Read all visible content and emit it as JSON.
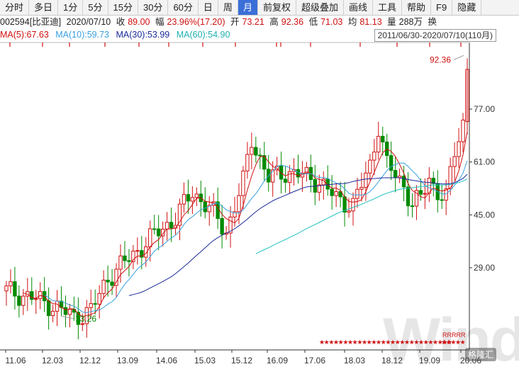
{
  "toolbar": {
    "buttons": [
      "分时",
      "多日",
      "1分",
      "5分",
      "15分",
      "30分",
      "60分",
      "日",
      "周",
      "月",
      "前复权",
      "超级叠加",
      "画线",
      "工具",
      "帮助",
      "F9",
      "隐藏"
    ],
    "active": "月"
  },
  "quote": {
    "code": "002594[比亚迪]",
    "date": "2020/07/10",
    "close_label": "收",
    "close": "89.00",
    "change_label": "幅",
    "change": "23.96%(17.20)",
    "open_label": "开",
    "open": "73.21",
    "high_label": "高",
    "high": "92.36",
    "low_label": "低",
    "low": "71.03",
    "avg_label": "均",
    "avg": "81.13",
    "vol_label": "量",
    "vol": "288万",
    "turnover_label": "换"
  },
  "ma": {
    "ma5": "MA(5):67.63",
    "ma10": "MA(10):59.73",
    "ma30": "MA(30):53.99",
    "ma60": "MA(60):54.90",
    "colors": {
      "ma5": "#d01010",
      "ma10": "#3aa0e0",
      "ma30": "#1a2a9a",
      "ma60": "#20c0c0"
    }
  },
  "range_label": "2011/06/30-2020/07/10(110月)",
  "chart_data": {
    "type": "candlestick",
    "price_ticks": [
      "77.00",
      "61.00",
      "45.00",
      "29.00"
    ],
    "price_tick_values": [
      77,
      61,
      45,
      29
    ],
    "x_labels": [
      "11.06",
      "12.03",
      "12.12",
      "13.09",
      "14.06",
      "15.03",
      "15.12",
      "16.09",
      "17.06",
      "18.03",
      "18.12",
      "19.09",
      "20.06"
    ],
    "high_marker": "92.36",
    "low_marker": "13.26",
    "marker_row": "★★★★★★★★★★★★★★★★★★★★★★★★★★★★",
    "marker_row2": "★★★★★",
    "r_tag": "RRRRR",
    "colors": {
      "up": "#d01010",
      "down": "#008a00",
      "axis": "#333333",
      "grid": "#e5e5e5"
    }
  },
  "watermark": "Wind",
  "badge": "格隆汇"
}
